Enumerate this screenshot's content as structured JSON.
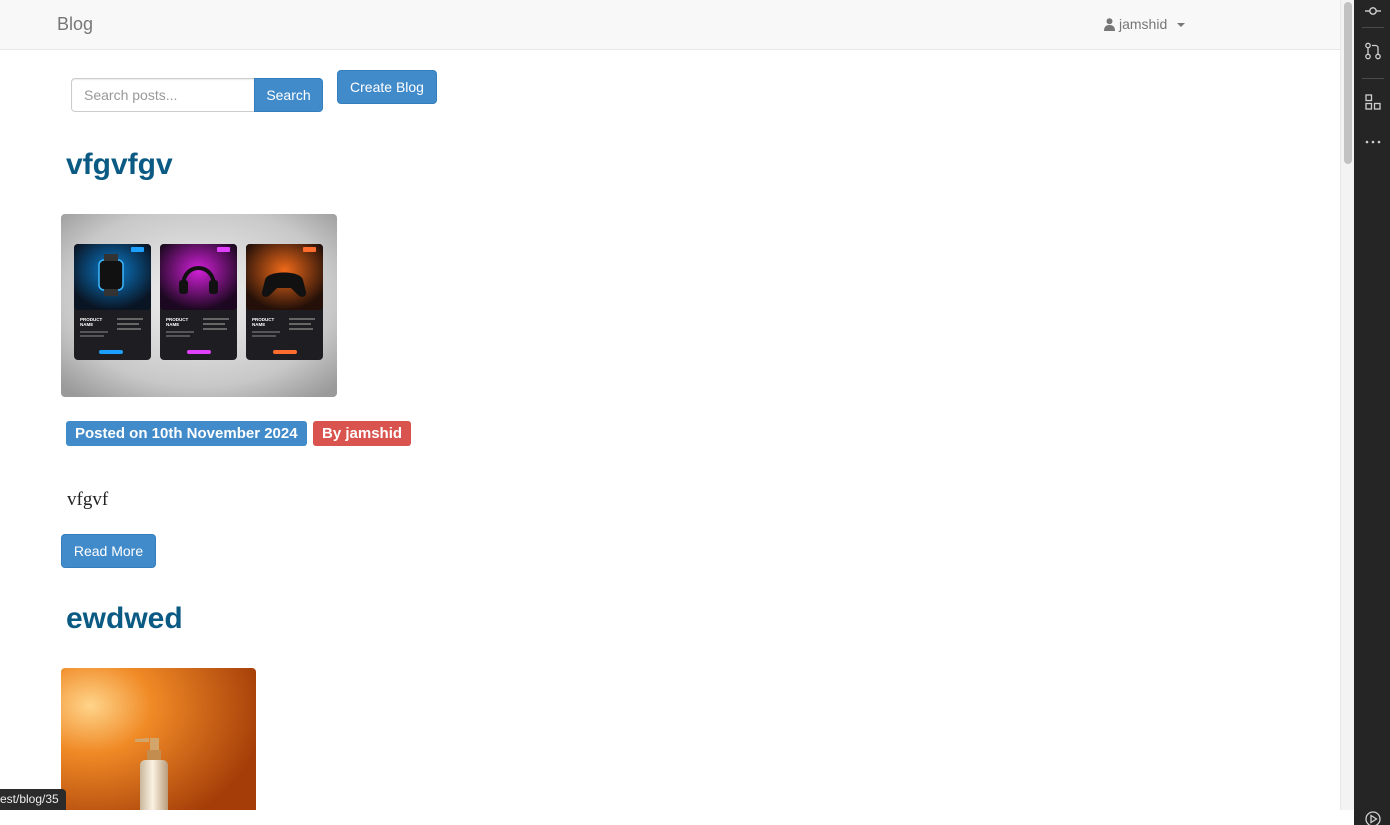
{
  "navbar": {
    "brand": "Blog",
    "user": "jamshid"
  },
  "search": {
    "placeholder": "Search posts...",
    "button_label": "Search"
  },
  "create_button_label": "Create Blog",
  "posts": [
    {
      "title": "vfgvfgv",
      "date_label": "Posted on 10th November 2024",
      "author_label": "By jamshid",
      "body": "vfgvf",
      "read_more": "Read More",
      "image": {
        "cards": [
          {
            "heading": "PRODUCT NAME",
            "accent": "#1ea0ff",
            "product": "smartwatch"
          },
          {
            "heading": "PRODUCT NAME",
            "accent": "#e040fb",
            "product": "headphones"
          },
          {
            "heading": "PRODUCT NAME",
            "accent": "#ff6d2e",
            "product": "gamepad"
          }
        ]
      }
    },
    {
      "title": "ewdwed",
      "image": {
        "product": "pump bottle"
      }
    }
  ],
  "status_url": "est/blog/35",
  "side_panel_icons": [
    "commit-icon",
    "pull-request-icon",
    "extensions-icon",
    "more-icon",
    "run-icon"
  ],
  "colors": {
    "primary": "#428bca",
    "danger": "#d9534f",
    "title": "#0b5a83"
  }
}
